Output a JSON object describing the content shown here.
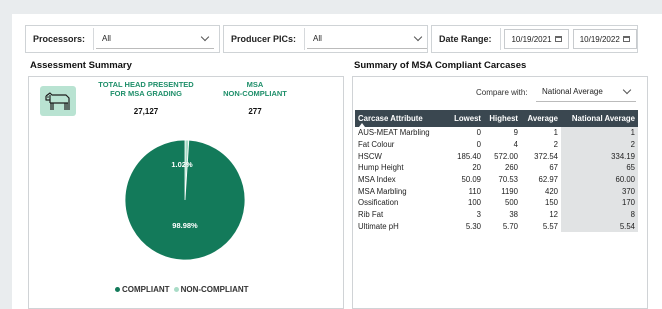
{
  "filters": {
    "processors": {
      "label": "Processors:",
      "value": "All"
    },
    "producer_pics": {
      "label": "Producer PICs:",
      "value": "All"
    },
    "date_range": {
      "label": "Date Range:",
      "start": "10/19/2021",
      "end": "10/19/2022"
    }
  },
  "assessment": {
    "title": "Assessment Summary",
    "kpi_total_label": "TOTAL HEAD PRESENTED FOR MSA GRADING",
    "kpi_total_line1": "TOTAL HEAD PRESENTED",
    "kpi_total_line2": "FOR MSA GRADING",
    "kpi_total_value": "27,127",
    "kpi_noncomp_line1": "MSA",
    "kpi_noncomp_line2": "NON-COMPLIANT",
    "kpi_noncomp_value": "277",
    "cow_icon": "cow-icon"
  },
  "chart_data": {
    "type": "pie",
    "slices": [
      {
        "name": "COMPLIANT",
        "value": 98.98,
        "label": "98.98%",
        "color": "#137a5a"
      },
      {
        "name": "NON-COMPLIANT",
        "value": 1.02,
        "label": "1.02%",
        "color": "#a9dcc7"
      }
    ],
    "legend": [
      "COMPLIANT",
      "NON-COMPLIANT"
    ],
    "legend_position": "bottom"
  },
  "summary": {
    "title": "Summary of MSA Compliant Carcases",
    "compare_label": "Compare with:",
    "compare_value": "National Average",
    "columns": [
      "Carcase Attribute",
      "Lowest",
      "Highest",
      "Average",
      "National Average"
    ],
    "rows": [
      [
        "AUS-MEAT Marbling",
        "0",
        "9",
        "1",
        "1"
      ],
      [
        "Fat Colour",
        "0",
        "4",
        "2",
        "2"
      ],
      [
        "HSCW",
        "185.40",
        "572.00",
        "372.54",
        "334.19"
      ],
      [
        "Hump Height",
        "20",
        "260",
        "67",
        "65"
      ],
      [
        "MSA Index",
        "50.09",
        "70.53",
        "62.97",
        "60.00"
      ],
      [
        "MSA Marbling",
        "110",
        "1190",
        "420",
        "370"
      ],
      [
        "Ossification",
        "100",
        "500",
        "150",
        "170"
      ],
      [
        "Rib Fat",
        "3",
        "38",
        "12",
        "8"
      ],
      [
        "Ultimate pH",
        "5.30",
        "5.70",
        "5.57",
        "5.54"
      ]
    ]
  },
  "colors": {
    "accent": "#1f8f6a",
    "compliant": "#137a5a",
    "noncompliant": "#a9dcc7",
    "table_header": "#3a4750"
  }
}
